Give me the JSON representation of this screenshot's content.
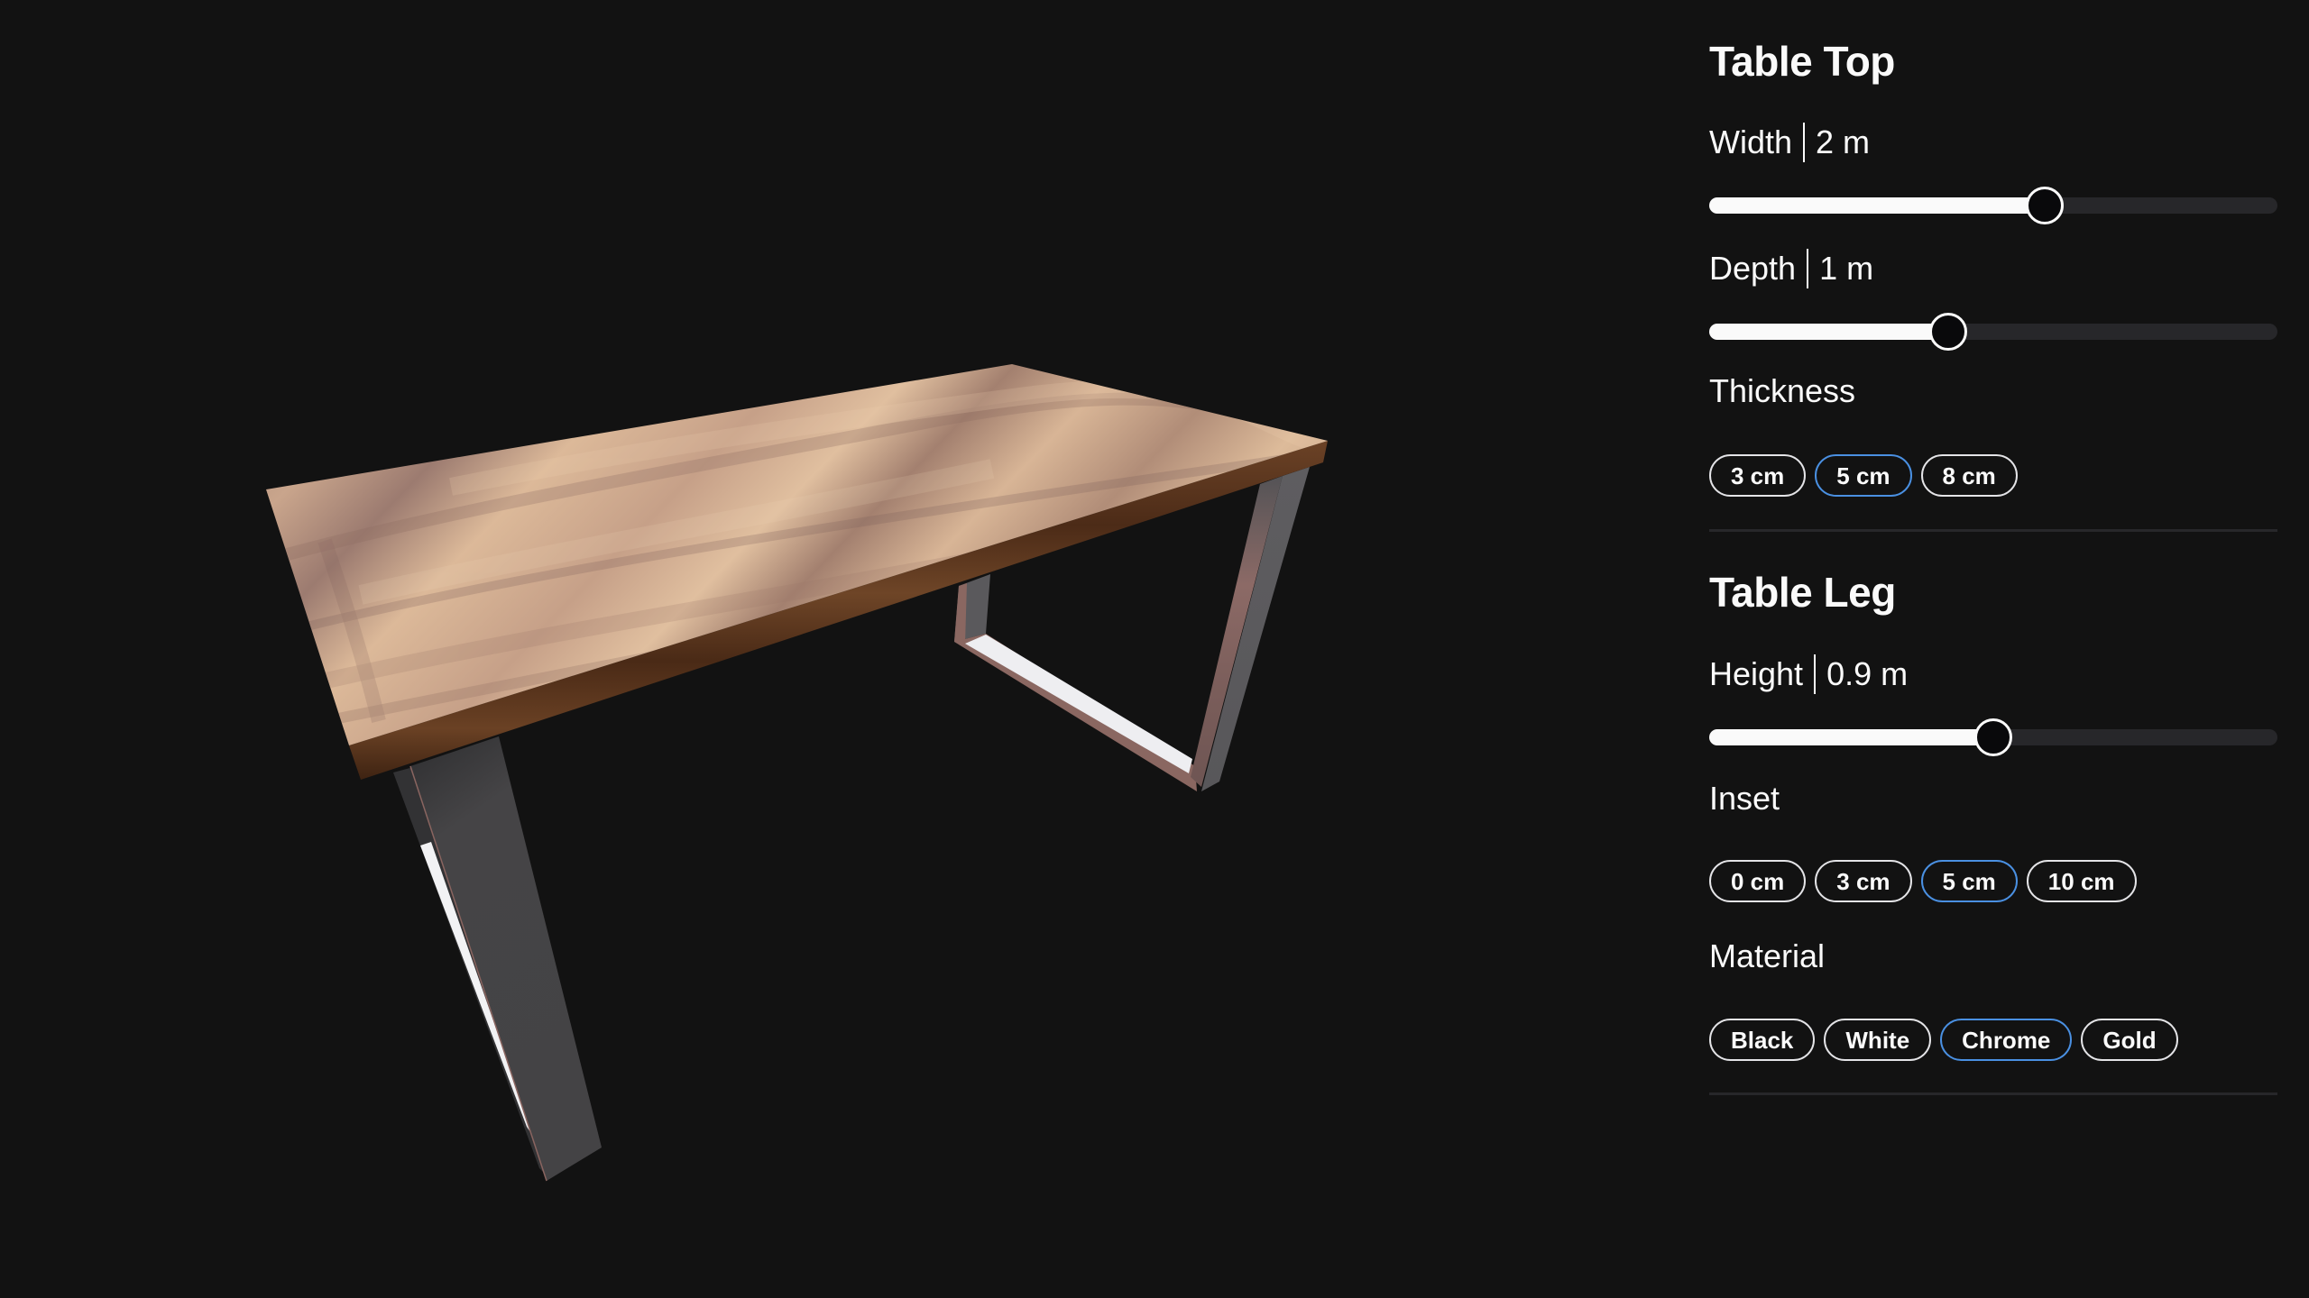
{
  "viewer": {
    "description": "3D table preview",
    "colors": {
      "background": "#121212",
      "wood_light": "#d9b595",
      "wood_mid": "#b89077",
      "wood_dark": "#7e5c52",
      "wood_edge": "#5a3418",
      "metal_dark": "#3e3e40",
      "metal_mid": "#5c5b5d",
      "metal_pink": "#8a6560",
      "metal_highlight": "#f0f0f2"
    }
  },
  "panel": {
    "accent_color": "#4a90e2",
    "table_top": {
      "title": "Table Top",
      "width": {
        "label": "Width",
        "value": "2 m",
        "fraction": 0.59
      },
      "depth": {
        "label": "Depth",
        "value": "1 m",
        "fraction": 0.42
      },
      "thickness": {
        "label": "Thickness",
        "options": [
          "3 cm",
          "5 cm",
          "8 cm"
        ],
        "selected": "5 cm"
      }
    },
    "table_leg": {
      "title": "Table Leg",
      "height": {
        "label": "Height",
        "value": "0.9 m",
        "fraction": 0.5
      },
      "inset": {
        "label": "Inset",
        "options": [
          "0 cm",
          "3 cm",
          "5 cm",
          "10 cm"
        ],
        "selected": "5 cm"
      },
      "material": {
        "label": "Material",
        "options": [
          "Black",
          "White",
          "Chrome",
          "Gold"
        ],
        "selected": "Chrome"
      }
    }
  }
}
